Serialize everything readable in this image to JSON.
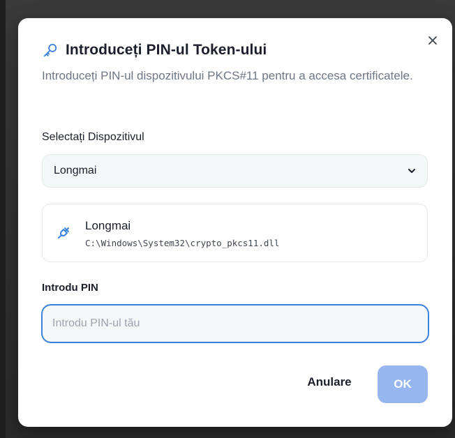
{
  "dialog": {
    "title": "Introduceți PIN-ul Token-ului",
    "subtitle": "Introduceți PIN-ul dispozitivului PKCS#11 pentru a accesa certificatele.",
    "close_icon": "close-icon",
    "title_icon": "key-icon"
  },
  "device_select": {
    "label": "Selectați Dispozitivul",
    "selected": "Longmai",
    "chevron_icon": "chevron-down-icon"
  },
  "device_card": {
    "icon": "usb-plug-icon",
    "name": "Longmai",
    "path": "C:\\Windows\\System32\\crypto_pkcs11.dll"
  },
  "pin": {
    "label": "Introdu PIN",
    "value": "",
    "placeholder": "Introdu PIN-ul tău"
  },
  "actions": {
    "cancel_label": "Anulare",
    "ok_label": "OK"
  },
  "colors": {
    "accent": "#3a82e0",
    "ok_disabled": "#96b6f0",
    "text": "#1a1f2b",
    "muted": "#6c7685"
  }
}
